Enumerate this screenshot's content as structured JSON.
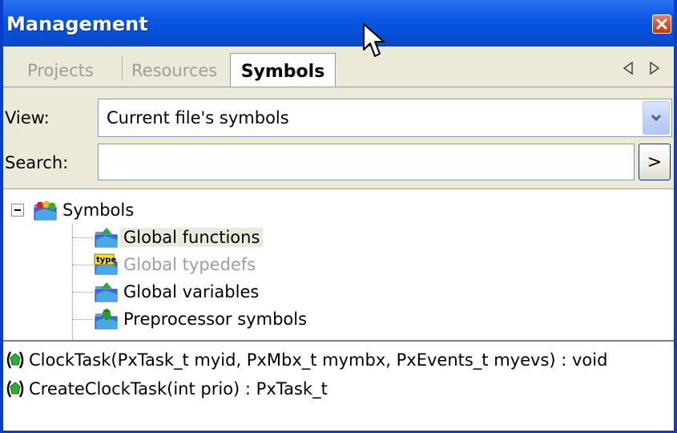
{
  "window": {
    "title": "Management"
  },
  "tabs": [
    {
      "label": "Projects",
      "active": false
    },
    {
      "label": "Resources",
      "active": false
    },
    {
      "label": "Symbols",
      "active": true
    }
  ],
  "tab_nav": {
    "prev_glyph": "◁",
    "next_glyph": "▷"
  },
  "filter": {
    "view_label": "View:",
    "view_value": "Current file's symbols",
    "search_label": "Search:",
    "search_value": "",
    "search_button": ">"
  },
  "tree": {
    "root": {
      "label": "Symbols",
      "icon": "symbols-folder-icon",
      "expanded": true
    },
    "children": [
      {
        "label": "Global functions",
        "icon": "folder-functions-icon",
        "selected": true,
        "disabled": false
      },
      {
        "label": "Global typedefs",
        "icon": "typedef-icon",
        "selected": false,
        "disabled": true
      },
      {
        "label": "Global variables",
        "icon": "folder-variables-icon",
        "selected": false,
        "disabled": false
      },
      {
        "label": "Preprocessor symbols",
        "icon": "folder-preprocessor-icon",
        "selected": false,
        "disabled": false
      }
    ]
  },
  "members": [
    {
      "label": "ClockTask(PxTask_t myid, PxMbx_t mymbx, PxEvents_t myevs) : void",
      "icon": "function-icon"
    },
    {
      "label": "CreateClockTask(int prio) : PxTask_t",
      "icon": "function-icon"
    }
  ],
  "colors": {
    "titlebar": "#0b57e3",
    "window_border": "#0a3ec9",
    "chrome": "#ece9d8",
    "close_button": "#d6532e",
    "selection": "#ebe8dc",
    "disabled_text": "#9e9e9e"
  }
}
